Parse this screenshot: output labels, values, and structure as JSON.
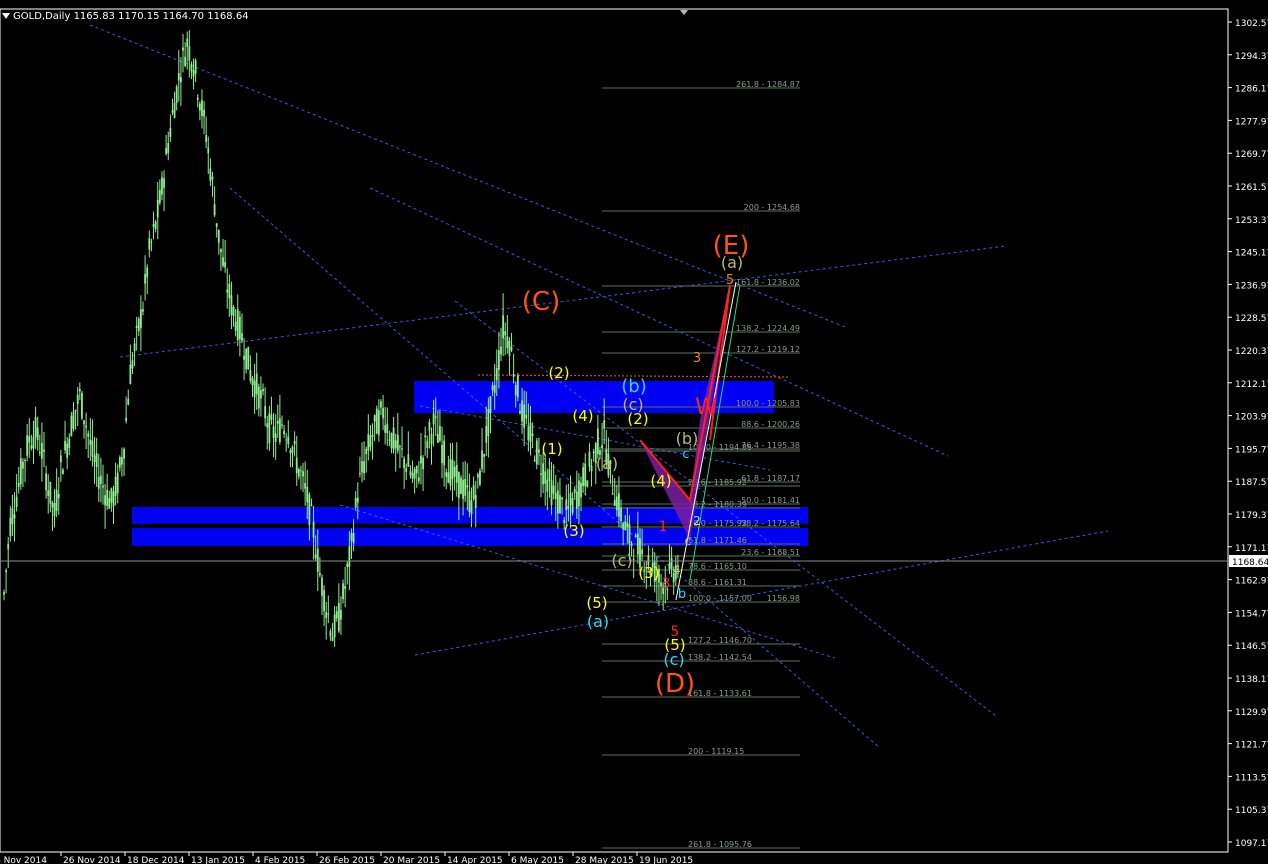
{
  "header": {
    "symbol": "GOLD,Daily",
    "open": "1165.83",
    "high": "1170.15",
    "low": "1164.70",
    "close": "1168.64"
  },
  "colors": {
    "background": "#000000",
    "candle": "#90ee90",
    "axis": "#ffffff",
    "zone": "#0000ff",
    "trendline": "#4a66ff",
    "fib": "#607060",
    "wave_red": "#ff5511",
    "wave_yellow": "#ffff00",
    "wave_cyan": "#22ddff",
    "wave_olive": "#bbbb66",
    "harmonic_fill": "#7b1fa2"
  },
  "chart_data": {
    "type": "candlestick",
    "title": "GOLD,Daily",
    "ohlc_last": {
      "open": 1165.83,
      "high": 1170.15,
      "low": 1164.7,
      "close": 1168.64
    },
    "current_price": "1168.64",
    "ylim": [
      1097.17,
      1306.5
    ],
    "y_ticks": [
      "1302.57",
      "1294.37",
      "1286.17",
      "1277.97",
      "1269.77",
      "1261.57",
      "1253.37",
      "1245.17",
      "1236.97",
      "1228.57",
      "1220.37",
      "1212.17",
      "1203.97",
      "1195.77",
      "1187.57",
      "1179.37",
      "1171.17",
      "1162.97",
      "1154.77",
      "1146.57",
      "1138.17",
      "1129.97",
      "1121.77",
      "1113.57",
      "1105.37",
      "1097.17"
    ],
    "x_ticks": [
      "4 Nov 2014",
      "26 Nov 2014",
      "18 Dec 2014",
      "13 Jan 2015",
      "4 Feb 2015",
      "26 Feb 2015",
      "20 Mar 2015",
      "14 Apr 2015",
      "6 May 2015",
      "28 May 2015",
      "19 Jun 2015"
    ],
    "price_path": [
      1160,
      1178,
      1185,
      1193,
      1199,
      1201,
      1196,
      1187,
      1180,
      1192,
      1198,
      1205,
      1210,
      1203,
      1195,
      1190,
      1186,
      1183,
      1188,
      1198,
      1216,
      1224,
      1233,
      1246,
      1253,
      1262,
      1274,
      1284,
      1293,
      1299,
      1294,
      1285,
      1276,
      1263,
      1250,
      1240,
      1233,
      1228,
      1223,
      1216,
      1212,
      1208,
      1202,
      1200,
      1203,
      1201,
      1195,
      1190,
      1184,
      1176,
      1165,
      1157,
      1150,
      1154,
      1162,
      1172,
      1186,
      1193,
      1199,
      1203,
      1206,
      1201,
      1197,
      1195,
      1192,
      1188,
      1193,
      1199,
      1203,
      1199,
      1193,
      1190,
      1188,
      1186,
      1183,
      1187,
      1197,
      1206,
      1216,
      1227,
      1224,
      1214,
      1206,
      1201,
      1197,
      1193,
      1189,
      1185,
      1183,
      1180,
      1183,
      1186,
      1190,
      1193,
      1198,
      1200,
      1190,
      1184,
      1178,
      1174,
      1172,
      1170,
      1168,
      1166,
      1163,
      1164,
      1166,
      1168
    ],
    "fibonacci_levels": [
      {
        "label": "261.8 - 1284.87"
      },
      {
        "label": "200 - 1254.68"
      },
      {
        "label": "161.8 - 1236.02"
      },
      {
        "label": "138.2 - 1224.49"
      },
      {
        "label": "127.2 - 1219.12"
      },
      {
        "label": "100.0 - 1205.83"
      },
      {
        "label": "88.6 - 1200.26"
      },
      {
        "label": "76.4 - 1195.38"
      },
      {
        "label": "100.0 - 1194.85"
      },
      {
        "label": "61.8 - 1187.17"
      },
      {
        "label": "23.6 - 1185.92"
      },
      {
        "label": "50.0 - 1181.41"
      },
      {
        "label": "38.2 - 1180.39"
      },
      {
        "label": "50.0 - 1175.92"
      },
      {
        "label": "38.2 - 1175.64"
      },
      {
        "label": "61.8 - 1171.46"
      },
      {
        "label": "23.6 - 1168.51"
      },
      {
        "label": "78.6 - 1165.10"
      },
      {
        "label": "88.6 - 1161.31"
      },
      {
        "label": "100.0 - 1157.00"
      },
      {
        "label": "1156.98"
      },
      {
        "label": "127.2 - 1146.70"
      },
      {
        "label": "138.2 - 1142.54"
      },
      {
        "label": "161.8 - 1133.61"
      },
      {
        "label": "200 - 1119.15"
      },
      {
        "label": "261.8 - 1095.76"
      }
    ],
    "wave_labels": [
      {
        "text": "(C)"
      },
      {
        "text": "(E)"
      },
      {
        "text": "(D)"
      },
      {
        "text": "(2)"
      },
      {
        "text": "(4)"
      },
      {
        "text": "(1)"
      },
      {
        "text": "(3)"
      },
      {
        "text": "(5)"
      },
      {
        "text": "(2)"
      },
      {
        "text": "(4)"
      },
      {
        "text": "(3)"
      },
      {
        "text": "(5)"
      },
      {
        "text": "(b)"
      },
      {
        "text": "(c)"
      },
      {
        "text": "(a)"
      },
      {
        "text": "(c)"
      },
      {
        "text": "(a)"
      },
      {
        "text": "(b)"
      },
      {
        "text": "(a)"
      },
      {
        "text": "(c)"
      },
      {
        "text": "3"
      },
      {
        "text": "5"
      },
      {
        "text": "W"
      },
      {
        "text": "1"
      },
      {
        "text": "3"
      },
      {
        "text": "5"
      },
      {
        "text": "c"
      },
      {
        "text": "b"
      },
      {
        "text": "c"
      },
      {
        "text": "2"
      },
      {
        "text": "4"
      }
    ]
  }
}
